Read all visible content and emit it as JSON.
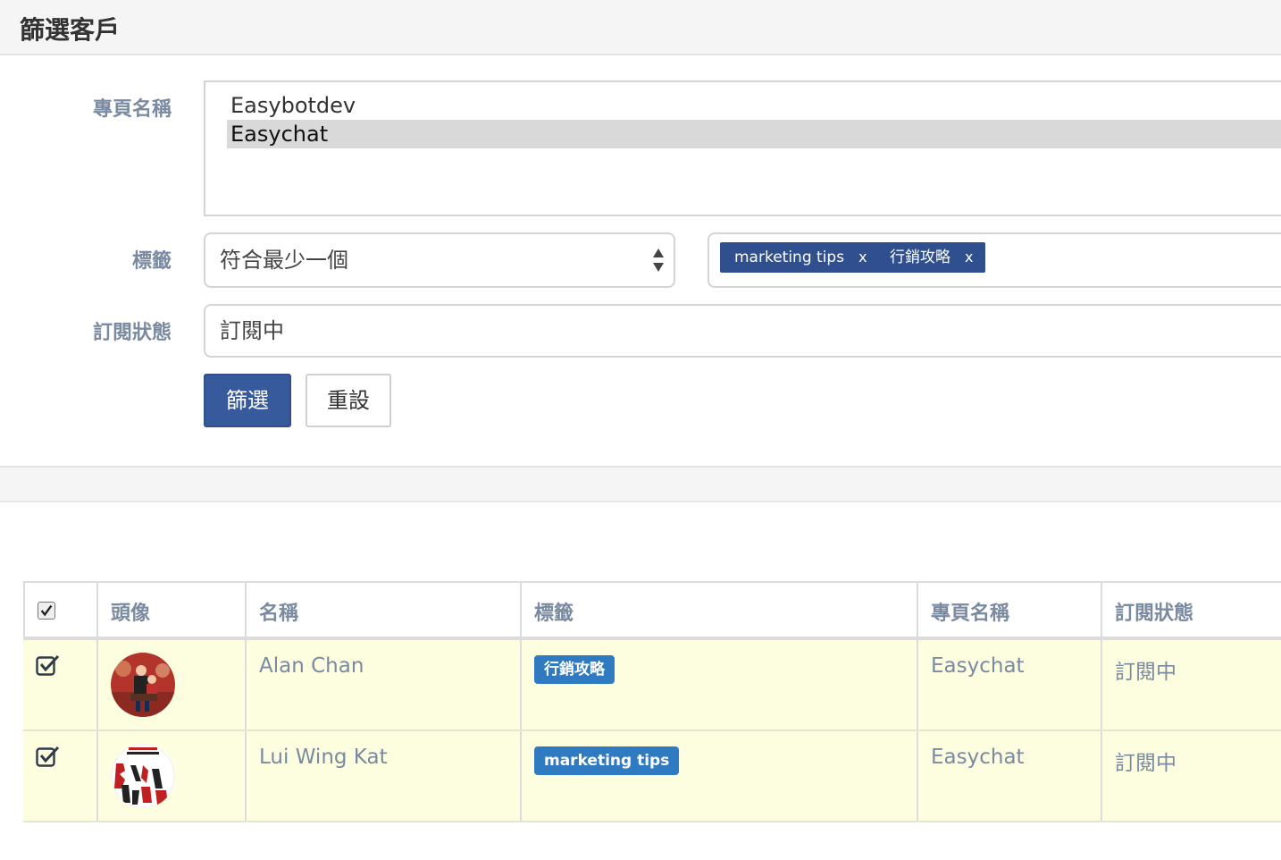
{
  "panel": {
    "title": "篩選客戶"
  },
  "form": {
    "page_name_label": "專頁名稱",
    "page_options": [
      {
        "label": "Easybotdev",
        "selected": false
      },
      {
        "label": "Easychat",
        "selected": true
      }
    ],
    "tags_label": "標籤",
    "match_mode": "符合最少一個",
    "tag_chips": [
      {
        "label": "marketing tips",
        "remove": "x"
      },
      {
        "label": "行銷攻略",
        "remove": "x"
      }
    ],
    "status_label": "訂閱狀態",
    "status_value": "訂閱中",
    "filter_button": "篩選",
    "reset_button": "重設"
  },
  "table": {
    "headers": [
      "頭像",
      "名稱",
      "標籤",
      "專頁名稱",
      "訂閱狀態"
    ],
    "rows": [
      {
        "checked": true,
        "avatar": "family-photo-avatar",
        "name": "Alan Chan",
        "tag": "行銷攻略",
        "page": "Easychat",
        "status": "訂閱中"
      },
      {
        "checked": true,
        "avatar": "band-logo-avatar",
        "name": "Lui Wing Kat",
        "tag": "marketing tips",
        "page": "Easychat",
        "status": "訂閱中"
      }
    ]
  },
  "colors": {
    "primary": "#375a9c",
    "chip": "#2f4f8f",
    "badge": "#2f7ac0",
    "row_highlight": "#fdfde0",
    "label": "#7a8aa0"
  }
}
